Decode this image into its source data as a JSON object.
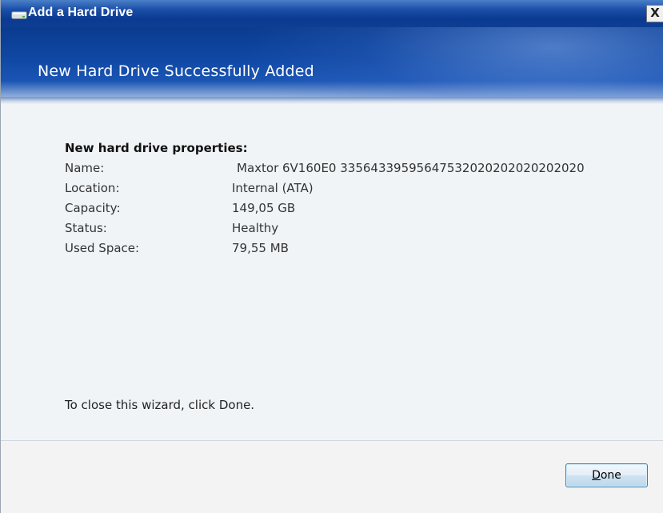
{
  "window": {
    "title": "Add a Hard Drive",
    "close_glyph": "X"
  },
  "banner": {
    "title": "New Hard Drive Successfully Added"
  },
  "properties": {
    "heading": "New hard drive properties:",
    "rows": [
      {
        "label": "Name:",
        "value": "Maxtor 6V160E0 33564339595647532020202020202020"
      },
      {
        "label": "Location:",
        "value": "Internal (ATA)"
      },
      {
        "label": "Capacity:",
        "value": "149,05 GB"
      },
      {
        "label": "Status:",
        "value": "Healthy"
      },
      {
        "label": "Used Space:",
        "value": "79,55 MB"
      }
    ]
  },
  "hint": "To close this wizard, click Done.",
  "footer": {
    "done_label_first": "D",
    "done_label_rest": "one"
  },
  "icons": {
    "title": "hard-drive-icon"
  },
  "colors": {
    "titlebar": "#0a3a91",
    "banner": "#0f47a3",
    "content_bg": "#f1f4f7",
    "button_border": "#3c7fb1"
  }
}
